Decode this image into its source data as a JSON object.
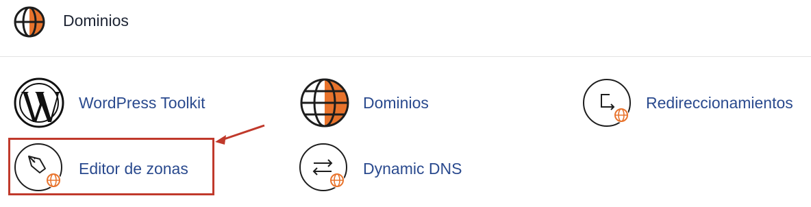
{
  "header": {
    "title": "Dominios",
    "icon": "globe-icon"
  },
  "tools": [
    {
      "id": "wordpress-toolkit",
      "label": "WordPress Toolkit",
      "icon": "wordpress-icon"
    },
    {
      "id": "dominios",
      "label": "Dominios",
      "icon": "globe-icon"
    },
    {
      "id": "redireccionamientos",
      "label": "Redireccionamientos",
      "icon": "redirect-icon"
    },
    {
      "id": "editor-de-zonas",
      "label": "Editor de zonas",
      "icon": "zone-editor-icon"
    },
    {
      "id": "dynamic-dns",
      "label": "Dynamic DNS",
      "icon": "dynamic-dns-icon"
    }
  ],
  "annotation": {
    "highlighted_tool": "editor-de-zonas",
    "color": "#c0392b"
  },
  "colors": {
    "accent": "#e8732c",
    "label": "#2a4a8e",
    "text": "#1d2433",
    "icon_stroke": "#1d1d1d"
  }
}
